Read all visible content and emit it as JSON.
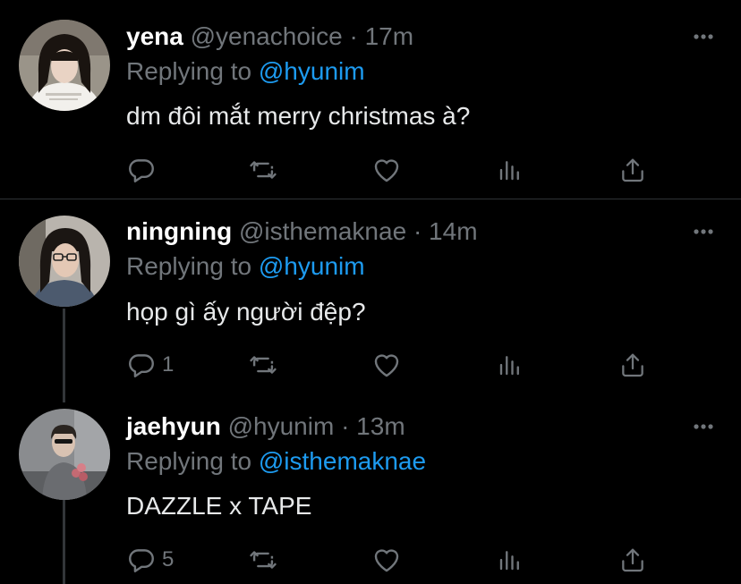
{
  "tweets": [
    {
      "name": "yena",
      "handle": "@yenachoice",
      "separator": "·",
      "time": "17m",
      "replying_prefix": "Replying to",
      "replying_to": "@hyunim",
      "text": "dm đôi mắt merry christmas à?",
      "reply_count": "",
      "avatar": {
        "bg": "#9a9489",
        "skin": "#e9d3c4",
        "hair": "#1a1410",
        "shirt": "#f2f0ec"
      }
    },
    {
      "name": "ningning",
      "handle": "@isthemaknae",
      "separator": "·",
      "time": "14m",
      "replying_prefix": "Replying to",
      "replying_to": "@hyunim",
      "text": "họp gì ấy người đệp?",
      "reply_count": "1",
      "avatar": {
        "bg": "#b9b4ad",
        "skin": "#e4c8b5",
        "hair": "#1b1613",
        "shirt": "#4c5a6e"
      }
    },
    {
      "name": "jaehyun",
      "handle": "@hyunim",
      "separator": "·",
      "time": "13m",
      "replying_prefix": "Replying to",
      "replying_to": "@isthemaknae",
      "text": "DAZZLE x TAPE",
      "reply_count": "5",
      "avatar": {
        "bg": "#8a8c8f",
        "skin": "#d8c2b2",
        "hair": "#2a2420",
        "shirt": "#6a6c70"
      }
    }
  ],
  "icons": {
    "reply": "reply-icon",
    "retweet": "retweet-icon",
    "like": "like-icon",
    "analytics": "analytics-icon",
    "share": "share-icon",
    "more": "more-icon"
  },
  "colors": {
    "background": "#000000",
    "name": "#ffffff",
    "secondary": "#71767b",
    "link": "#1d9bf0",
    "divider": "#2f3336"
  }
}
